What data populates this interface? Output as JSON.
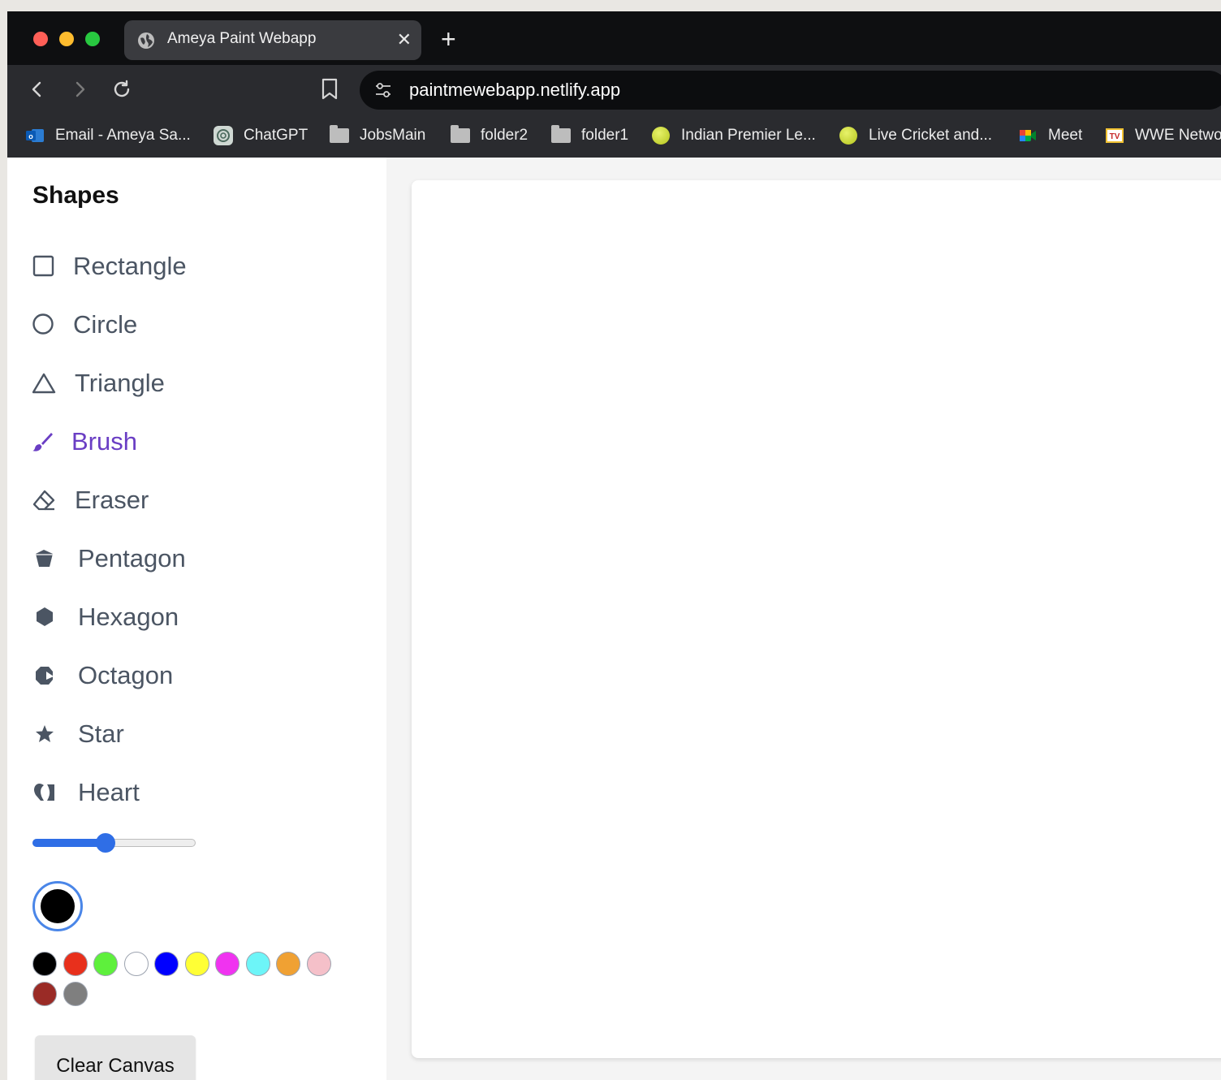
{
  "browser": {
    "tab_title": "Ameya Paint Webapp",
    "tab_close": "✕",
    "new_tab": "+",
    "url": "paintmewebapp.netlify.app",
    "bookmarks": [
      {
        "label": "Email - Ameya Sa...",
        "icon": "outlook-icon"
      },
      {
        "label": "ChatGPT",
        "icon": "chatgpt-icon"
      },
      {
        "label": "JobsMain",
        "icon": "folder-icon"
      },
      {
        "label": "folder2",
        "icon": "folder-icon"
      },
      {
        "label": "folder1",
        "icon": "folder-icon"
      },
      {
        "label": "Indian Premier Le...",
        "icon": "ball-icon"
      },
      {
        "label": "Live Cricket and...",
        "icon": "ball-icon"
      },
      {
        "label": "Meet",
        "icon": "meet-icon"
      },
      {
        "label": "WWE Netwo",
        "icon": "tv-icon"
      }
    ]
  },
  "sidebar": {
    "title": "Shapes",
    "tools": [
      {
        "label": "Rectangle",
        "icon": "square-outline-icon"
      },
      {
        "label": "Circle",
        "icon": "circle-outline-icon"
      },
      {
        "label": "Triangle",
        "icon": "triangle-outline-icon"
      },
      {
        "label": "Brush",
        "icon": "brush-icon",
        "active": true
      },
      {
        "label": "Eraser",
        "icon": "eraser-icon"
      },
      {
        "label": "Pentagon",
        "icon": "pentagon-icon"
      },
      {
        "label": "Hexagon",
        "icon": "hexagon-icon"
      },
      {
        "label": "Octagon",
        "icon": "octagon-icon"
      },
      {
        "label": "Star",
        "icon": "star-icon"
      },
      {
        "label": "Heart",
        "icon": "heart-icon"
      }
    ],
    "brush_size_fraction": 0.45,
    "selected_color": "#000000",
    "swatches": [
      "#000000",
      "#e8301c",
      "#5ef03c",
      "#ffffff",
      "#0000ff",
      "#ffff35",
      "#f033f0",
      "#6df5f8",
      "#f0a133",
      "#f5c0c9",
      "#9a2b26",
      "#7f7f7f"
    ],
    "clear_label": "Clear Canvas"
  },
  "colors": {
    "accent": "#6a3ec4",
    "slider": "#2f6ee6"
  }
}
